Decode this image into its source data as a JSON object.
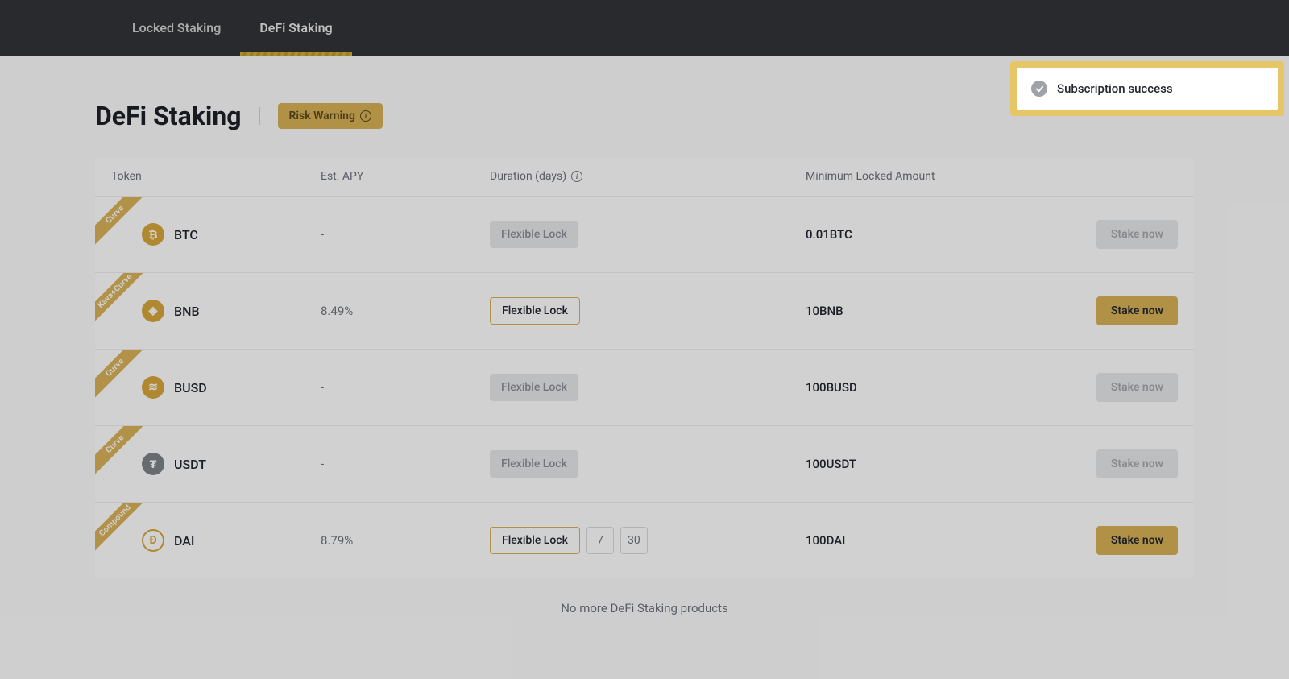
{
  "header": {
    "tabs": [
      {
        "label": "Locked Staking",
        "active": false
      },
      {
        "label": "DeFi Staking",
        "active": true
      }
    ]
  },
  "page": {
    "title": "DeFi Staking",
    "risk_warning": "Risk Warning",
    "footer": "No more DeFi Staking products"
  },
  "toast": {
    "message": "Subscription success"
  },
  "table": {
    "headers": {
      "token": "Token",
      "apy": "Est. APY",
      "duration": "Duration (days)",
      "min": "Minimum Locked Amount"
    },
    "rows": [
      {
        "ribbon": "Curve",
        "token": "BTC",
        "icon_bg": "#d7a73a",
        "icon_glyph": "₿",
        "apy": "-",
        "durations": [
          {
            "label": "Flexible Lock",
            "style": "disabled"
          }
        ],
        "min": "0.01BTC",
        "stake_label": "Stake now",
        "stake_style": "disabled"
      },
      {
        "ribbon": "Kava+Curve",
        "token": "BNB",
        "icon_bg": "#d7a73a",
        "icon_glyph": "◈",
        "apy": "8.49%",
        "durations": [
          {
            "label": "Flexible Lock",
            "style": "active"
          }
        ],
        "min": "10BNB",
        "stake_label": "Stake now",
        "stake_style": "active"
      },
      {
        "ribbon": "Curve",
        "token": "BUSD",
        "icon_bg": "#d7a73a",
        "icon_glyph": "≋",
        "apy": "-",
        "durations": [
          {
            "label": "Flexible Lock",
            "style": "disabled"
          }
        ],
        "min": "100BUSD",
        "stake_label": "Stake now",
        "stake_style": "disabled"
      },
      {
        "ribbon": "Curve",
        "token": "USDT",
        "icon_bg": "#7e8388",
        "icon_glyph": "₮",
        "apy": "-",
        "durations": [
          {
            "label": "Flexible Lock",
            "style": "disabled"
          }
        ],
        "min": "100USDT",
        "stake_label": "Stake now",
        "stake_style": "disabled"
      },
      {
        "ribbon": "Compound",
        "token": "DAI",
        "icon_bg": "#ffffff",
        "icon_border": "#d7a73a",
        "icon_color": "#d7a73a",
        "icon_glyph": "Đ",
        "apy": "8.79%",
        "durations": [
          {
            "label": "Flexible Lock",
            "style": "active"
          },
          {
            "label": "7",
            "style": "option"
          },
          {
            "label": "30",
            "style": "option"
          }
        ],
        "min": "100DAI",
        "stake_label": "Stake now",
        "stake_style": "active"
      }
    ]
  }
}
